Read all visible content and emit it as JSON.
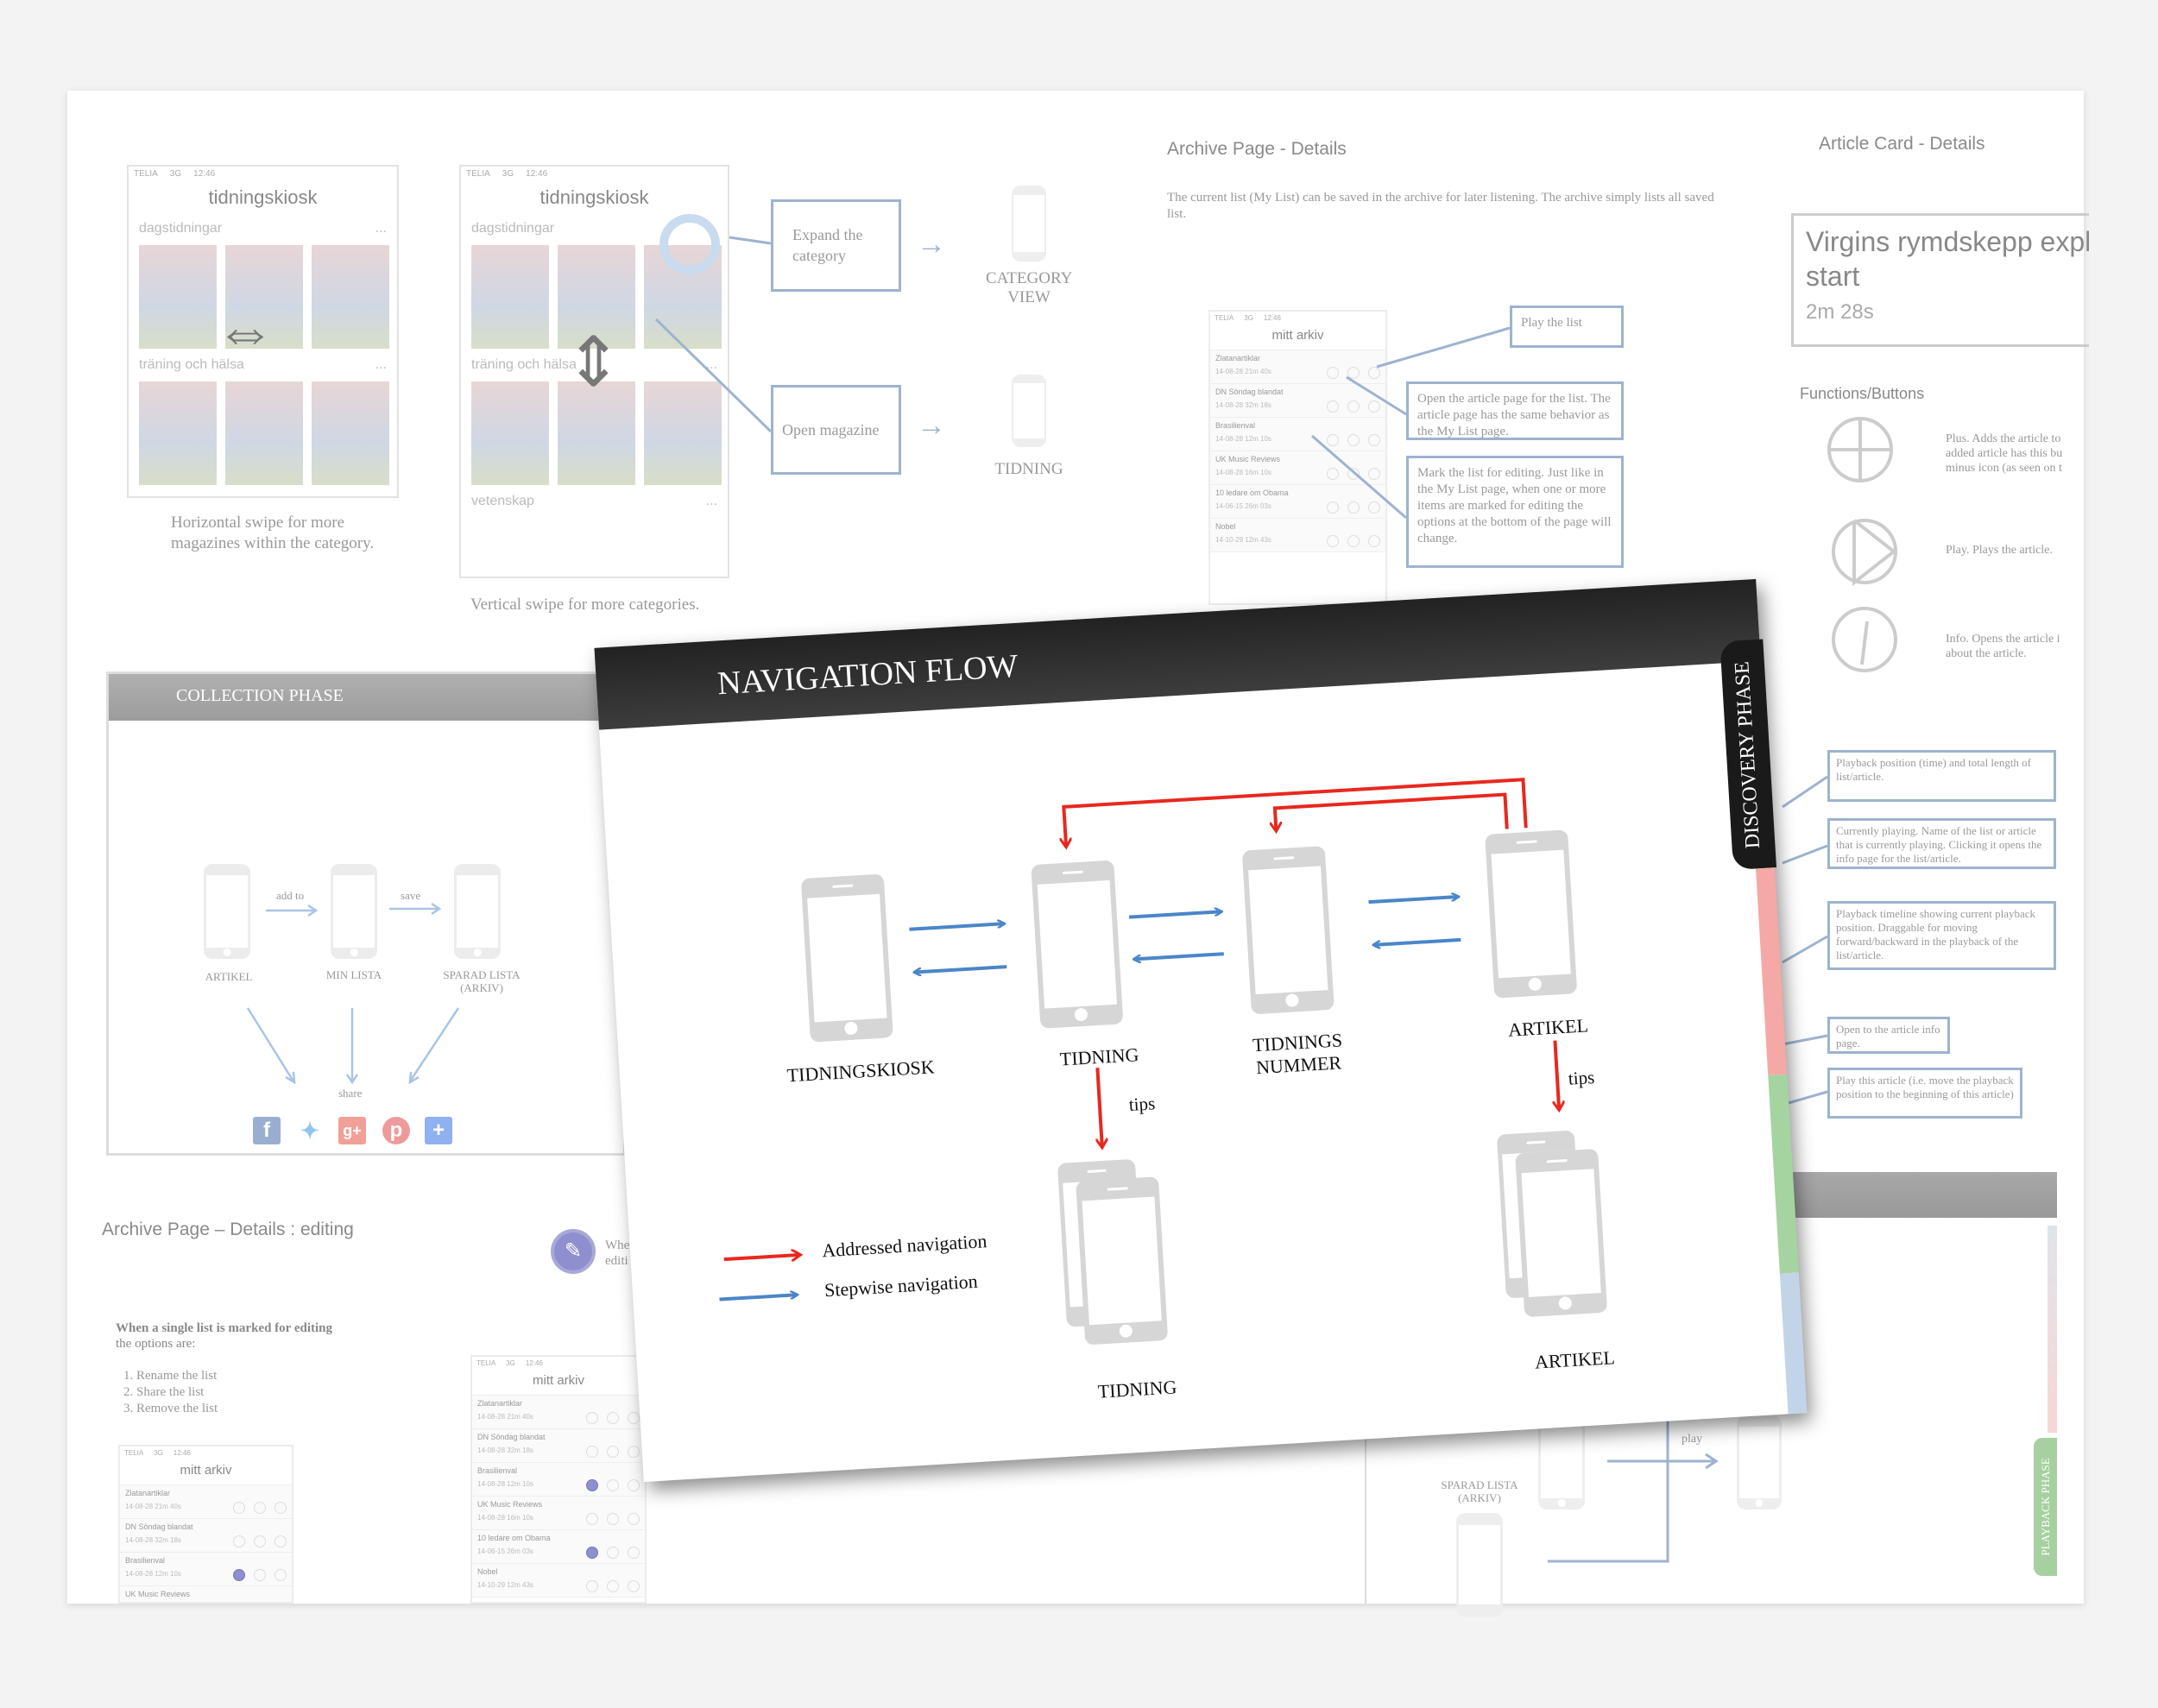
{
  "kiosk": {
    "status": {
      "carrier": "TELIA",
      "network": "3G",
      "time": "12:46"
    },
    "title": "tidningskiosk",
    "categories": [
      "dagstidningar",
      "träning och hälsa",
      "vetenskap"
    ],
    "more": "...",
    "caption_horizontal": "Horizontal swipe for more magazines within the category.",
    "caption_vertical": "Vertical swipe for more categories.",
    "box_expand": "Expand the category",
    "box_open": "Open magazine",
    "target_category": "CATEGORY VIEW",
    "target_tidning": "TIDNING"
  },
  "archive": {
    "heading": "Archive Page - Details",
    "description": "The current list (My List) can be saved in the archive for later listening. The archive simply lists all saved list.",
    "phone_title": "mitt arkiv",
    "items": [
      {
        "name": "Zlatanartiklar",
        "date": "14-08-28",
        "length": "21m 40s"
      },
      {
        "name": "DN Söndag blandat",
        "date": "14-08-28",
        "length": "32m 18s"
      },
      {
        "name": "Brasilienval",
        "date": "14-08-28",
        "length": "12m 10s"
      },
      {
        "name": "UK Music Reviews",
        "date": "14-08-28",
        "length": "16m 10s"
      },
      {
        "name": "10 ledare om Obama",
        "date": "14-06-15",
        "length": "26m 03s"
      },
      {
        "name": "Nobel",
        "date": "14-10-29",
        "length": "12m 43s"
      }
    ],
    "box_play": "Play the list",
    "box_open": "Open the article page for the list. The article page has the same behavior as the My List page.",
    "box_mark": "Mark the list for editing. Just like in the My List page, when one or more items are marked for editing the options at the bottom of the page will change."
  },
  "article_card": {
    "heading": "Article Card - Details",
    "title": "Virgins rymdskepp expl",
    "title_line2": "start",
    "duration": "2m 28s",
    "functions_heading": "Functions/Buttons",
    "functions": [
      {
        "icon": "plus-circle-icon",
        "text": "Plus. Adds the article to",
        "text2": "added article has this bu",
        "text3": "minus icon (as seen on t"
      },
      {
        "icon": "play-circle-icon",
        "text": "Play. Plays the article."
      },
      {
        "icon": "info-circle-icon",
        "text": "Info. Opens the article i",
        "text2": "about the article."
      }
    ]
  },
  "playback_notes": [
    "Playback position (time) and total length of list/article.",
    "Currently playing. Name of the list or article that is currently playing. Clicking it opens the info page for the list/article.",
    "Playback timeline showing current playback position. Draggable for moving forward/backward in the playback of the list/article.",
    "Open to the article info page.",
    "Play this article (i.e. move the playback position to the beginning of this article)"
  ],
  "collection": {
    "title": "COLLECTION PHASE",
    "phones": [
      "ARTIKEL",
      "MIN LISTA",
      "SPARAD LISTA (ARKIV)"
    ],
    "add_to": "add to",
    "save": "save",
    "share": "share",
    "share_icons": [
      "facebook-icon",
      "twitter-icon",
      "google-plus-icon",
      "pinterest-icon",
      "add-share-icon"
    ]
  },
  "editing": {
    "heading": "Archive Page – Details : editing",
    "intro_bold": "When a single list is marked for editing",
    "intro_rest": " the options are:",
    "options": [
      "Rename the list",
      "Share the list",
      "Remove the list"
    ],
    "side_text": "Whe",
    "side_text2": "editi",
    "marked_phone1": [
      "Brasilienval"
    ],
    "marked_phone2": [
      "Brasilienval",
      "10 ledare om Obama"
    ]
  },
  "playback": {
    "tab": "PLAYBACK PHASE",
    "sparad": "SPARAD LISTA (ARKIV)",
    "play": "play"
  },
  "nav": {
    "title": "NAVIGATION FLOW",
    "tab": "DISCOVERY PHASE",
    "screens": [
      "TIDNINGSKIOSK",
      "TIDNING",
      "TIDNINGS NUMMER",
      "ARTIKEL"
    ],
    "sub_screens": [
      "TIDNING",
      "ARTIKEL"
    ],
    "tips": "tips",
    "legend": [
      {
        "label": "Addressed navigation",
        "color": "#e8281e"
      },
      {
        "label": "Stepwise navigation",
        "color": "#4a86c8"
      }
    ]
  },
  "colors": {
    "addressed": "#e8281e",
    "stepwise": "#4a86c8",
    "discovery": "#1a1a1a",
    "pink": "#f4a9a6",
    "green": "#a6d4a0",
    "blue": "#c2d4e8"
  }
}
